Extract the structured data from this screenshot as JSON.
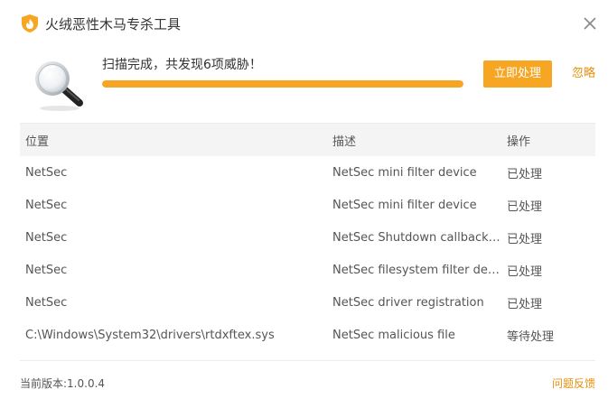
{
  "window": {
    "title": "火绒恶性木马专杀工具",
    "logo_icon": "huorong-flame-shield-icon",
    "close_icon": "close-icon"
  },
  "scan": {
    "status_text": "扫描完成，共发现6项威胁！",
    "progress_percent": 100,
    "progress_color": "#f6a623",
    "icon": "magnifier-icon",
    "primary_button": "立即处理",
    "ignore_link": "忽略"
  },
  "table": {
    "columns": [
      "位置",
      "描述",
      "操作"
    ],
    "rows": [
      {
        "location": "NetSec",
        "description": "NetSec mini filter device",
        "action": "已处理"
      },
      {
        "location": "NetSec",
        "description": "NetSec mini filter device",
        "action": "已处理"
      },
      {
        "location": "NetSec",
        "description": "NetSec Shutdown callback ro...",
        "action": "已处理"
      },
      {
        "location": "NetSec",
        "description": "NetSec filesystem filter device",
        "action": "已处理"
      },
      {
        "location": "NetSec",
        "description": "NetSec driver registration",
        "action": "已处理"
      },
      {
        "location": "C:\\Windows\\System32\\drivers\\rtdxftex.sys",
        "description": "NetSec malicious file",
        "action": "等待处理"
      }
    ]
  },
  "footer": {
    "version": "当前版本:1.0.0.4",
    "feedback": "问题反馈"
  },
  "colors": {
    "accent": "#f6a623",
    "link": "#e8900c"
  }
}
